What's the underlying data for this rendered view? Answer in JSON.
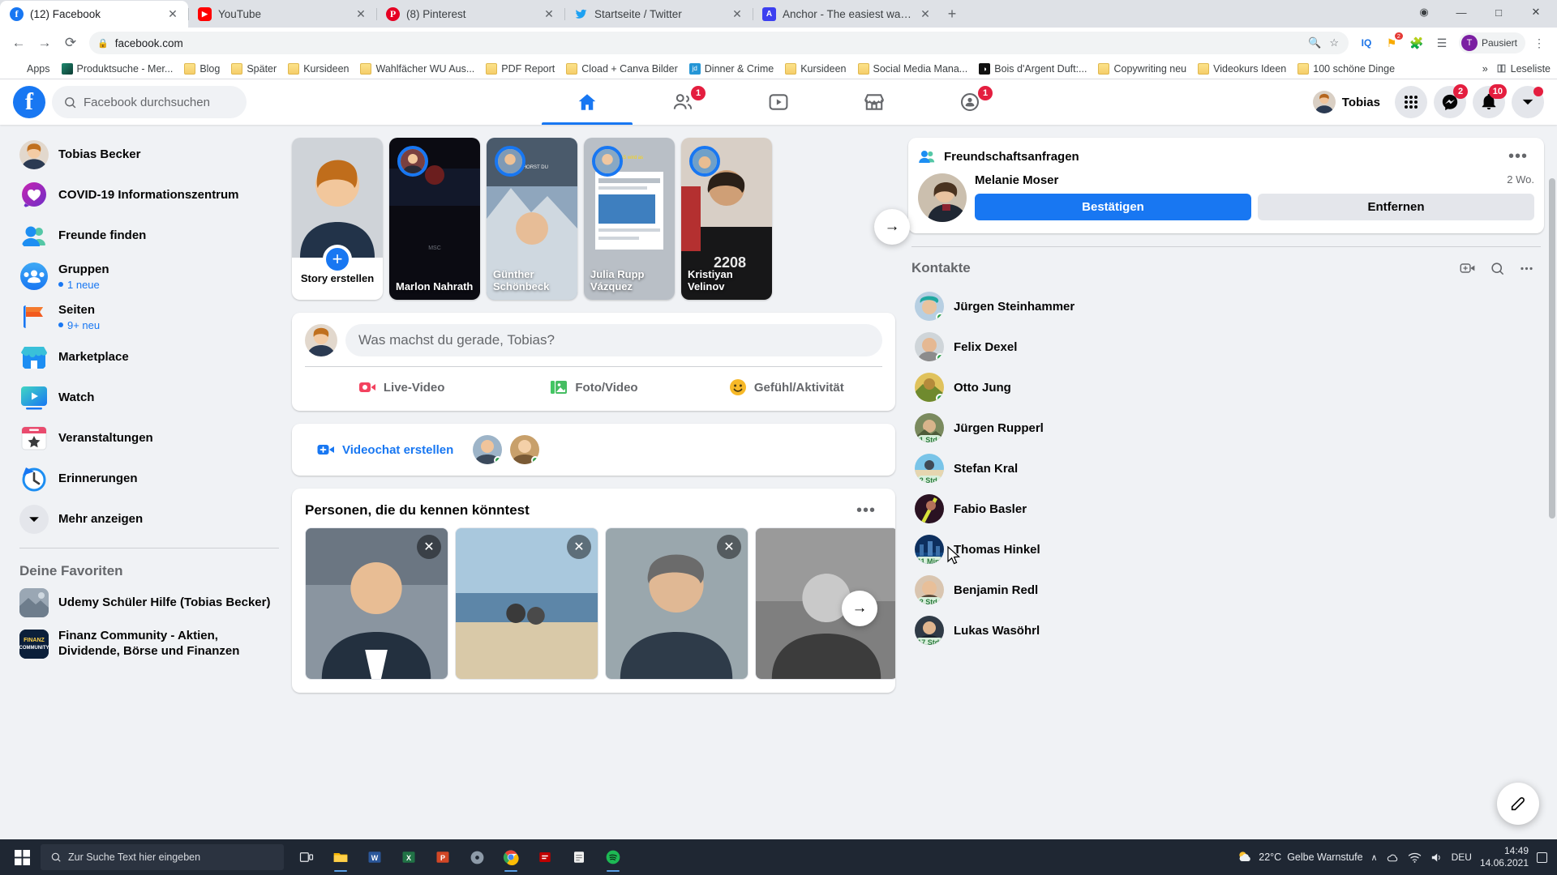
{
  "browser": {
    "tabs": [
      {
        "title": "(12) Facebook",
        "favicon": "facebook-icon",
        "glyph": "f",
        "active": true
      },
      {
        "title": "YouTube",
        "favicon": "youtube-icon",
        "glyph": "▶",
        "active": false
      },
      {
        "title": "(8) Pinterest",
        "favicon": "pinterest-icon",
        "glyph": "P",
        "active": false
      },
      {
        "title": "Startseite / Twitter",
        "favicon": "twitter-icon",
        "glyph": "ᴠ",
        "active": false
      },
      {
        "title": "Anchor - The easiest way to mak...",
        "favicon": "anchor-icon",
        "glyph": "A",
        "active": false
      }
    ],
    "new_tab_label": "+",
    "window_controls": {
      "minimize": "—",
      "maximize": "☐",
      "close": "✕",
      "extra": "⊙"
    },
    "toolbar": {
      "back": "←",
      "forward": "→",
      "reload": "⟳",
      "lock": "🔒",
      "url": "facebook.com",
      "zoom_icon": "zoom-icon",
      "star_icon": "star-icon",
      "profile_name": "Pausiert",
      "profile_initial": "T"
    },
    "bookmarks": [
      {
        "label": "Apps",
        "icon": "apps-grid-icon"
      },
      {
        "label": "Produktsuche - Mer...",
        "icon": "site-icon"
      },
      {
        "label": "Blog",
        "icon": "folder-icon"
      },
      {
        "label": "Später",
        "icon": "folder-icon"
      },
      {
        "label": "Kursideen",
        "icon": "folder-icon"
      },
      {
        "label": "Wahlfächer WU Aus...",
        "icon": "folder-icon"
      },
      {
        "label": "PDF Report",
        "icon": "folder-icon"
      },
      {
        "label": "Cload + Canva Bilder",
        "icon": "folder-icon"
      },
      {
        "label": "Dinner & Crime",
        "icon": "jd-icon"
      },
      {
        "label": "Kursideen",
        "icon": "folder-icon"
      },
      {
        "label": "Social Media Mana...",
        "icon": "folder-icon"
      },
      {
        "label": "Bois d'Argent Duft:...",
        "icon": "bois-icon"
      },
      {
        "label": "Copywriting neu",
        "icon": "folder-icon"
      },
      {
        "label": "Videokurs Ideen",
        "icon": "folder-icon"
      },
      {
        "label": "100 schöne Dinge",
        "icon": "folder-icon"
      }
    ],
    "bookmarks_overflow": "»",
    "reading_list": "Leseliste"
  },
  "facebook": {
    "search_placeholder": "Facebook durchsuchen",
    "nav_tabs": [
      {
        "name": "home",
        "icon": "home-icon",
        "active": true,
        "badge": ""
      },
      {
        "name": "friends",
        "icon": "friends-icon",
        "active": false,
        "badge": "1"
      },
      {
        "name": "watch",
        "icon": "watch-icon",
        "active": false,
        "badge": ""
      },
      {
        "name": "marketplace",
        "icon": "marketplace-icon",
        "active": false,
        "badge": ""
      },
      {
        "name": "groups",
        "icon": "groups-icon",
        "active": false,
        "badge": "1"
      }
    ],
    "me_name": "Tobias",
    "header_buttons": [
      {
        "name": "menu-grid",
        "icon": "grid-icon",
        "badge": ""
      },
      {
        "name": "messenger",
        "icon": "messenger-icon",
        "badge": "2"
      },
      {
        "name": "notifications",
        "icon": "bell-icon",
        "badge": "10"
      },
      {
        "name": "account",
        "icon": "chevron-down-icon",
        "badge": "dot"
      }
    ],
    "sidebar": {
      "items": [
        {
          "label": "Tobias Becker",
          "icon": "profile-avatar",
          "sub": ""
        },
        {
          "label": "COVID-19 Informationszentrum",
          "icon": "covid-icon",
          "sub": ""
        },
        {
          "label": "Freunde finden",
          "icon": "friends-icon",
          "sub": ""
        },
        {
          "label": "Gruppen",
          "icon": "groups-icon",
          "sub": "1 neue"
        },
        {
          "label": "Seiten",
          "icon": "pages-flag-icon",
          "sub": "9+ neu"
        },
        {
          "label": "Marketplace",
          "icon": "marketplace-icon",
          "sub": ""
        },
        {
          "label": "Watch",
          "icon": "watch-icon",
          "sub": ""
        },
        {
          "label": "Veranstaltungen",
          "icon": "events-icon",
          "sub": ""
        },
        {
          "label": "Erinnerungen",
          "icon": "memories-icon",
          "sub": ""
        },
        {
          "label": "Mehr anzeigen",
          "icon": "chevron-down-icon",
          "sub": ""
        }
      ],
      "favorites_title": "Deine Favoriten",
      "favorites": [
        {
          "label": "Udemy Schüler Hilfe (Tobias Becker)",
          "icon": "udemy-group-icon"
        },
        {
          "label": "Finanz Community - Aktien, Dividende, Börse und Finanzen",
          "icon": "finanz-group-icon"
        }
      ]
    },
    "stories": {
      "create_label": "Story erstellen",
      "items": [
        {
          "name": "Marlon Nahrath"
        },
        {
          "name": "Günther Schönbeck"
        },
        {
          "name": "Julia Rupp Vázquez"
        },
        {
          "name": "Kristiyan Velinov"
        }
      ],
      "next_label": "→"
    },
    "composer": {
      "placeholder": "Was machst du gerade, Tobias?",
      "actions": [
        {
          "label": "Live-Video",
          "icon": "live-video-icon"
        },
        {
          "label": "Foto/Video",
          "icon": "photo-video-icon"
        },
        {
          "label": "Gefühl/Aktivität",
          "icon": "feeling-icon"
        }
      ]
    },
    "videochat": {
      "label": "Videochat erstellen",
      "icon": "video-plus-icon"
    },
    "pyk": {
      "title": "Personen, die du kennen könntest",
      "more": "•••",
      "next": "→",
      "close": "✕"
    },
    "friend_requests": {
      "title": "Freundschaftsanfragen",
      "more": "•••",
      "icon": "friend-requests-icon",
      "person": {
        "name": "Melanie Moser",
        "time": "2 Wo."
      },
      "confirm_label": "Bestätigen",
      "remove_label": "Entfernen"
    },
    "contacts": {
      "title": "Kontakte",
      "actions": [
        {
          "name": "new-video-chat",
          "icon": "video-plus-icon"
        },
        {
          "name": "search-contacts",
          "icon": "search-icon"
        },
        {
          "name": "contacts-options",
          "icon": "dots-icon"
        }
      ],
      "items": [
        {
          "name": "Jürgen Steinhammer",
          "status": "online",
          "ago": ""
        },
        {
          "name": "Felix Dexel",
          "status": "online",
          "ago": ""
        },
        {
          "name": "Otto Jung",
          "status": "online",
          "ago": ""
        },
        {
          "name": "Jürgen Rupperl",
          "status": "away",
          "ago": "1 Std."
        },
        {
          "name": "Stefan Kral",
          "status": "away",
          "ago": "2 Std."
        },
        {
          "name": "Fabio Basler",
          "status": "away",
          "ago": ""
        },
        {
          "name": "Thomas Hinkel",
          "status": "away",
          "ago": "11 Min."
        },
        {
          "name": "Benjamin Redl",
          "status": "away",
          "ago": "2 Std."
        },
        {
          "name": "Lukas Wasöhrl",
          "status": "away",
          "ago": "17 Std."
        }
      ]
    },
    "compose_fab": "pencil-icon"
  },
  "taskbar": {
    "search_placeholder": "Zur Suche Text hier eingeben",
    "apps": [
      {
        "name": "task-view-icon"
      },
      {
        "name": "file-explorer-icon"
      },
      {
        "name": "word-icon"
      },
      {
        "name": "excel-icon"
      },
      {
        "name": "powerpoint-icon"
      },
      {
        "name": "cd-icon"
      },
      {
        "name": "chrome-icon"
      },
      {
        "name": "filezilla-icon"
      },
      {
        "name": "notes-icon"
      },
      {
        "name": "spotify-icon"
      }
    ],
    "weather": {
      "temp": "22°C",
      "desc": "Gelbe Warnstufe"
    },
    "tray": {
      "chevron": "∧",
      "wifi": "wifi-icon",
      "volume": "volume-icon",
      "cloud": "cloud-icon",
      "lang": "DEU"
    },
    "clock": {
      "time": "14:49",
      "date": "14.06.2021"
    }
  }
}
